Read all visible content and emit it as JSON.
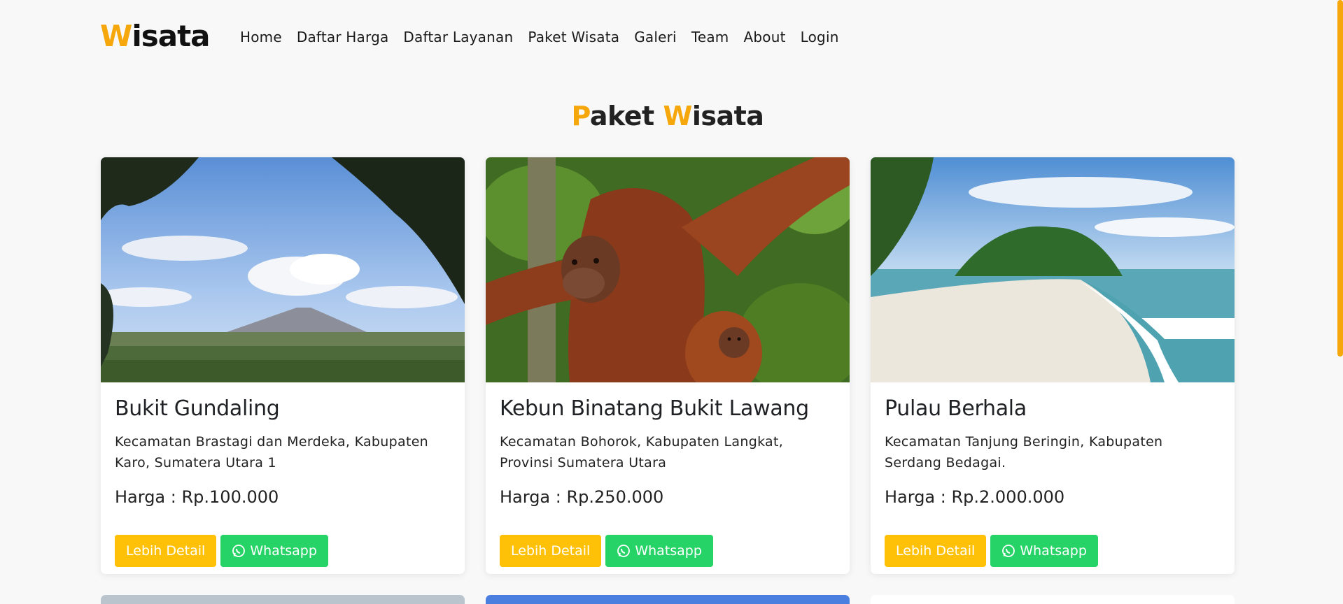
{
  "brand": {
    "first_letter": "W",
    "rest": "isata"
  },
  "nav": [
    "Home",
    "Daftar Harga",
    "Daftar Layanan",
    "Paket Wisata",
    "Galeri",
    "Team",
    "About",
    "Login"
  ],
  "section": {
    "title_p": "P",
    "title_aket": "aket ",
    "title_w": "W",
    "title_isata": "isata"
  },
  "colors": {
    "accent": "#f5a70c",
    "detail_button": "#fec107",
    "whatsapp_button": "#25d366"
  },
  "cards": [
    {
      "title": "Bukit Gundaling",
      "location": "Kecamatan Brastagi dan Merdeka, Kabupaten Karo, Sumatera Utara 1",
      "price": "Harga : Rp.100.000",
      "detail_label": "Lebih Detail",
      "wa_label": "Whatsapp",
      "image_icon": "mountain-landscape-photo"
    },
    {
      "title": "Kebun Binatang Bukit Lawang",
      "location": "Kecamatan Bohorok, Kabupaten Langkat, Provinsi Sumatera Utara",
      "price": "Harga : Rp.250.000",
      "detail_label": "Lebih Detail",
      "wa_label": "Whatsapp",
      "image_icon": "orangutan-photo"
    },
    {
      "title": "Pulau Berhala",
      "location": "Kecamatan Tanjung Beringin, Kabupaten Serdang Bedagai.",
      "price": "Harga : Rp.2.000.000",
      "detail_label": "Lebih Detail",
      "wa_label": "Whatsapp",
      "image_icon": "beach-island-photo"
    }
  ]
}
